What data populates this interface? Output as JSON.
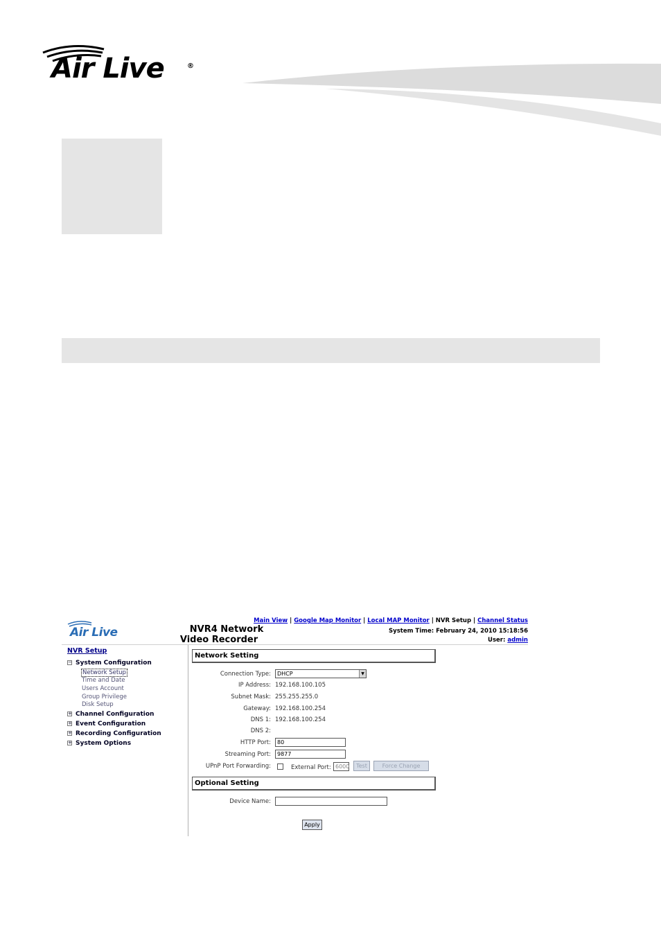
{
  "brand": {
    "logo_text": "Air Live",
    "registered_mark": "®",
    "color": "#000000"
  },
  "nvr": {
    "logo_text": "Air Live",
    "logo_color": "#2a6db5",
    "title_line1": "NVR4 Network",
    "title_line2": "Video Recorder",
    "nav": {
      "main_view": "Main View",
      "google_map": "Google Map Monitor",
      "local_map": "Local MAP Monitor",
      "nvr_setup": "NVR Setup",
      "channel_status": "Channel Status",
      "sep": "|"
    },
    "system_time": "System Time: February 24, 2010 15:18:56",
    "user_label": "User:",
    "user_name": "admin",
    "sidebar": {
      "root": "NVR Setup",
      "system_config": {
        "toggle": "−",
        "label": "System Configuration"
      },
      "items": [
        "Network Setup",
        "Time and Date",
        "Users Account",
        "Group Privilege",
        "Disk Setup"
      ],
      "sections": [
        {
          "toggle": "+",
          "label": "Channel Configuration"
        },
        {
          "toggle": "+",
          "label": "Event Configuration"
        },
        {
          "toggle": "+",
          "label": "Recording Configuration"
        },
        {
          "toggle": "+",
          "label": "System Options"
        }
      ]
    },
    "network": {
      "heading": "Network Setting",
      "connection_type_label": "Connection Type:",
      "connection_type_value": "DHCP",
      "ip_label": "IP Address:",
      "ip_value": "192.168.100.105",
      "mask_label": "Subnet Mask:",
      "mask_value": "255.255.255.0",
      "gateway_label": "Gateway:",
      "gateway_value": "192.168.100.254",
      "dns1_label": "DNS 1:",
      "dns1_value": "192.168.100.254",
      "dns2_label": "DNS 2:",
      "http_label": "HTTP Port:",
      "http_value": "80",
      "stream_label": "Streaming Port:",
      "stream_value": "9877",
      "upnp_label": "UPnP Port Forwarding:",
      "ext_port_label": "External Port:",
      "ext_port_value": "6000",
      "test_button": "Test",
      "force_button": "Force Change"
    },
    "optional": {
      "heading": "Optional Setting",
      "device_name_label": "Device Name:",
      "device_name_value": "",
      "apply_button": "Apply"
    }
  }
}
